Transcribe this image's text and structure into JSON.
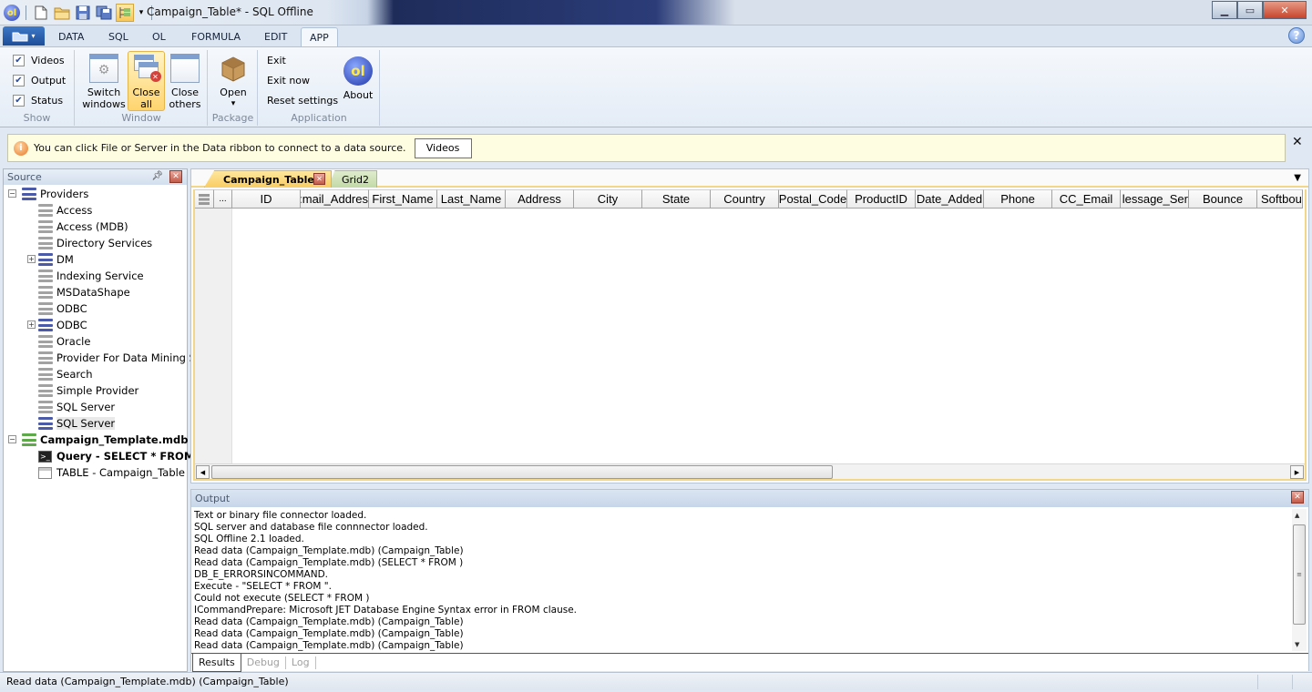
{
  "window": {
    "title": "Campaign_Table* - SQL Offline",
    "app_logo": "ol",
    "controls": {
      "minimize": "minimize-icon",
      "maximize": "maximize-icon",
      "close": "close-icon"
    }
  },
  "quick_access": [
    "new-document-icon",
    "open-folder-icon",
    "save-icon",
    "save-all-icon",
    "tree-view-icon",
    "customize-dropdown-icon"
  ],
  "ribbon": {
    "file_button_icon": "folder-icon",
    "tabs": [
      {
        "label": "DATA",
        "active": false
      },
      {
        "label": "SQL",
        "active": false
      },
      {
        "label": "OL",
        "active": false
      },
      {
        "label": "FORMULA",
        "active": false
      },
      {
        "label": "EDIT",
        "active": false
      },
      {
        "label": "APP",
        "active": true
      }
    ],
    "help_label": "?",
    "groups": {
      "show": {
        "label": "Show",
        "checkboxes": [
          {
            "label": "Videos",
            "checked": true
          },
          {
            "label": "Output",
            "checked": true
          },
          {
            "label": "Status",
            "checked": true
          }
        ]
      },
      "window": {
        "label": "Window",
        "buttons": [
          {
            "line1": "Switch",
            "line2": "windows"
          },
          {
            "line1": "Close",
            "line2": "all"
          },
          {
            "line1": "Close",
            "line2": "others"
          }
        ]
      },
      "package": {
        "label": "Package",
        "open_label": "Open",
        "dropdown": "▾"
      },
      "application": {
        "label": "Application",
        "actions": [
          "Exit",
          "Exit now",
          "Reset settings"
        ],
        "about_label": "About",
        "about_logo": "ol"
      }
    }
  },
  "infobar": {
    "icon": "i",
    "message": "You can click File or Server in the Data ribbon to connect to a data source.",
    "button": "Videos",
    "close": "✕"
  },
  "source": {
    "title": "Source",
    "tree": [
      {
        "label": "Providers",
        "level": 0,
        "expander": "−",
        "icon": "blue",
        "bold": false
      },
      {
        "label": "Access",
        "level": 1,
        "icon": "grey"
      },
      {
        "label": "Access (MDB)",
        "level": 1,
        "icon": "grey"
      },
      {
        "label": "Directory Services",
        "level": 1,
        "icon": "grey"
      },
      {
        "label": "DM",
        "level": 1,
        "expander": "+",
        "icon": "blue"
      },
      {
        "label": "Indexing Service",
        "level": 1,
        "icon": "grey"
      },
      {
        "label": "MSDataShape",
        "level": 1,
        "icon": "grey"
      },
      {
        "label": "ODBC",
        "level": 1,
        "icon": "grey"
      },
      {
        "label": "ODBC",
        "level": 1,
        "expander": "+",
        "icon": "blue"
      },
      {
        "label": "Oracle",
        "level": 1,
        "icon": "grey"
      },
      {
        "label": "Provider For Data Mining S",
        "level": 1,
        "icon": "grey"
      },
      {
        "label": "Search",
        "level": 1,
        "icon": "grey"
      },
      {
        "label": "Simple Provider",
        "level": 1,
        "icon": "grey"
      },
      {
        "label": "SQL Server",
        "level": 1,
        "icon": "grey"
      },
      {
        "label": "SQL Server",
        "level": 1,
        "icon": "blue",
        "selected": true
      },
      {
        "label": "Campaign_Template.mdb",
        "level": 0,
        "expander": "−",
        "icon": "green",
        "bold": true
      },
      {
        "label": "Query - SELECT * FROM",
        "level": 1,
        "icon": "query",
        "bold": true
      },
      {
        "label": "TABLE - Campaign_Table",
        "level": 1,
        "icon": "table"
      }
    ]
  },
  "documents": {
    "tabs": [
      {
        "label": "Campaign_Table*",
        "active": true
      },
      {
        "label": "Grid2",
        "active": false
      }
    ],
    "grid": {
      "columns": [
        "ID",
        "Email_Address",
        "First_Name",
        "Last_Name",
        "Address",
        "City",
        "State",
        "Country",
        "Postal_Code",
        "ProductID",
        "Date_Added",
        "Phone",
        "CC_Email",
        "Message_Sent",
        "Bounce",
        "Softbounce"
      ],
      "visible_headers": [
        "ID",
        ":mail_Addres",
        "First_Name",
        "Last_Name",
        "Address",
        "City",
        "State",
        "Country",
        "Postal_Code",
        "ProductID",
        "Date_Added",
        "Phone",
        "CC_Email",
        "lessage_Ser",
        "Bounce",
        "Softbour"
      ],
      "rows": [],
      "corner_more": "..."
    }
  },
  "output": {
    "title": "Output",
    "lines": [
      "Text or binary file connector loaded.",
      "SQL server and database file connnector loaded.",
      "SQL Offline 2.1 loaded.",
      "Read data (Campaign_Template.mdb) (Campaign_Table)",
      "Read data (Campaign_Template.mdb) (SELECT * FROM )",
      "DB_E_ERRORSINCOMMAND.",
      "Execute - \"SELECT * FROM \".",
      "Could not execute (SELECT * FROM )",
      "ICommandPrepare: Microsoft JET Database Engine Syntax error in FROM clause.",
      "Read data (Campaign_Template.mdb) (Campaign_Table)",
      "Read data (Campaign_Template.mdb) (Campaign_Table)",
      "Read data (Campaign_Template.mdb) (Campaign_Table)"
    ],
    "tabs": [
      {
        "label": "Results",
        "active": true
      },
      {
        "label": "Debug",
        "active": false
      },
      {
        "label": "Log",
        "active": false
      }
    ]
  },
  "status": {
    "text": "Read data (Campaign_Template.mdb) (Campaign_Table)"
  },
  "colors": {
    "active_tab": "#f8cd63",
    "inactive_tab": "#c3d9a6",
    "infobar_bg": "#fefde1",
    "close_red": "#c65a48"
  }
}
